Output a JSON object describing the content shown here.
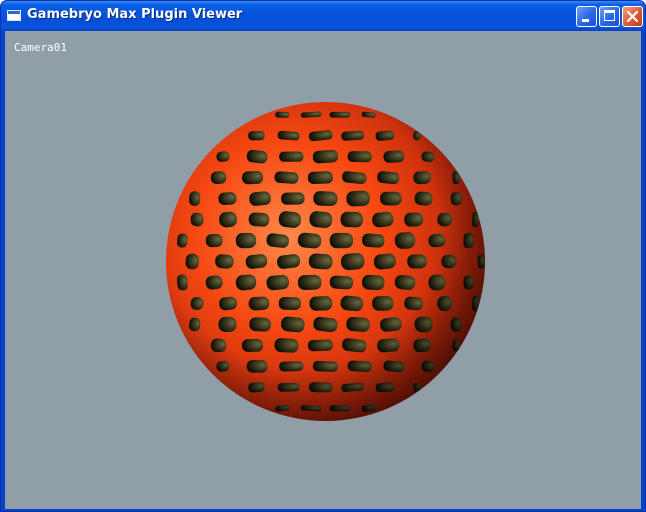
{
  "window": {
    "title": "Gamebryo Max Plugin Viewer"
  },
  "viewport": {
    "camera_label": "Camera01",
    "background_color": "#8f9ea7",
    "object": "textured-sphere-lava-cells"
  },
  "colors": {
    "titlebar": "#0653dd",
    "lava": "#ff4a12",
    "stone": "#4a4a26"
  },
  "icons": {
    "app": "window-icon",
    "minimize": "minimize-icon",
    "maximize": "maximize-icon",
    "close": "close-icon"
  }
}
